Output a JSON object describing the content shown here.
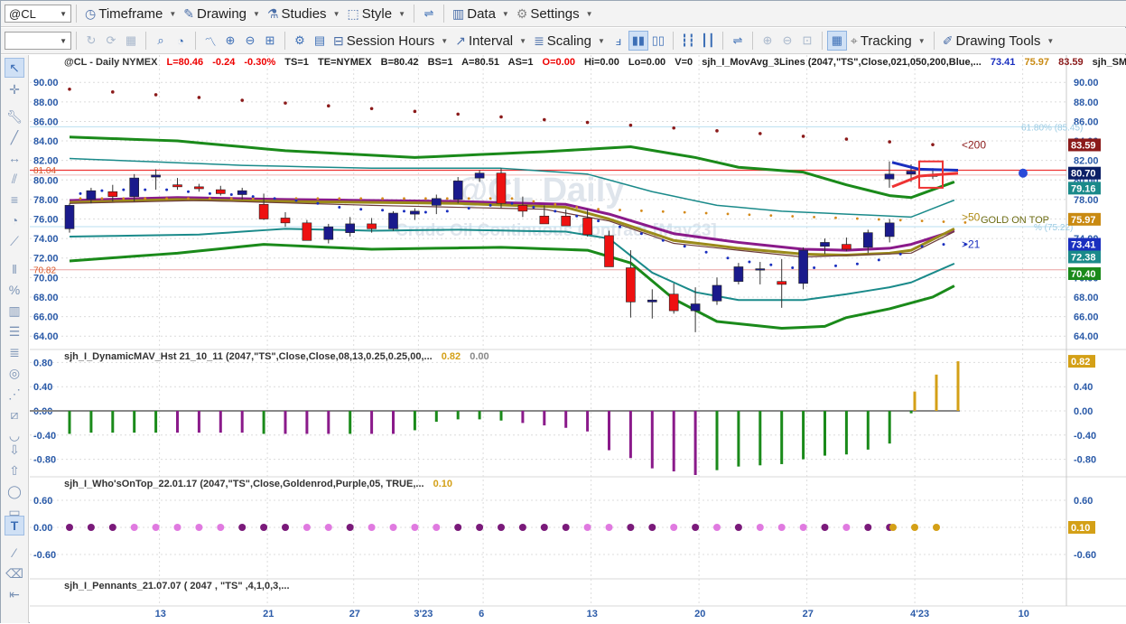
{
  "toolbar1": {
    "symbol": "@CL",
    "timeframe": "Timeframe",
    "drawing": "Drawing",
    "studies": "Studies",
    "style": "Style",
    "data": "Data",
    "settings": "Settings"
  },
  "toolbar2": {
    "session_hours": "Session Hours",
    "interval": "Interval",
    "scaling": "Scaling",
    "tracking": "Tracking",
    "drawing_tools": "Drawing Tools"
  },
  "header": {
    "symbol": "@CL - Daily  NYMEX",
    "last": "L=80.46",
    "change": "-0.24",
    "pct": "-0.30%",
    "ts": "TS=1",
    "te": "TE=NYMEX",
    "bid": "B=80.42",
    "bs": "BS=1",
    "ask": "A=80.51",
    "as": "AS=1",
    "open": "O=0.00",
    "hi": "Hi=0.00",
    "lo": "Lo=0.00",
    "vol": "V=0",
    "study1": "sjh_I_MovAvg_3Lines (2047,\"TS\",Close,021,050,200,Blue,...",
    "study1_v1": "73.41",
    "study1_v2": "75.97",
    "study1_v3": "83.59",
    "study2": "sjh_SM_Curr..."
  },
  "watermark": {
    "title": "@CL Daily",
    "subtitle": "Crude Oil Continuous Contract [May23]"
  },
  "annotations": {
    "ma200": "<200",
    "ma50": ">50",
    "ma21": ">21",
    "gold": "GOLD ON TOP",
    "fib618": "61.80% (85.45)",
    "fib": "% (75.22)",
    "hline_top": "81.04",
    "hline_bot": "70.82"
  },
  "colors": {
    "up": "#1a1a8c",
    "down": "#ee1111",
    "purple": "#8a1a8a",
    "green": "#1a8a1a",
    "gold": "#d4a017",
    "teal": "#1a8a8a"
  },
  "price_pane": {
    "axis_ticks": [
      "90.00",
      "88.00",
      "86.00",
      "84.00",
      "82.00",
      "80.00",
      "78.00",
      "76.00",
      "74.00",
      "72.00",
      "70.00",
      "68.00",
      "66.00",
      "64.00"
    ],
    "tags": [
      {
        "text": "83.59",
        "color": "#8b1a1a"
      },
      {
        "text": "80.70",
        "color": "#0b1f66"
      },
      {
        "text": "79.16",
        "color": "#1a8a8a"
      },
      {
        "text": "75.97",
        "color": "#c98a12"
      },
      {
        "text": "73.41",
        "color": "#1a2fbf"
      },
      {
        "text": "72.38",
        "color": "#1a8a8a"
      },
      {
        "text": "70.40",
        "color": "#1a8a1a"
      }
    ]
  },
  "pane2": {
    "title": "sjh_I_DynamicMAV_Hst 21_10_11 (2047,\"TS\",Close,Close,08,13,0.25,0.25,00,...",
    "v1": "0.82",
    "v2": "0.00",
    "axis_ticks": [
      "0.80",
      "0.40",
      "0.00",
      "-0.40",
      "-0.80"
    ],
    "tags": [
      "0.82",
      "-0.00"
    ]
  },
  "pane3": {
    "title": "sjh_I_Who'sOnTop_22.01.17 (2047,\"TS\",Close,Goldenrod,Purple,05, TRUE,...",
    "v1": "0.10",
    "axis_ticks": [
      "0.60",
      "0.00",
      "-0.60"
    ],
    "tag": "0.10"
  },
  "pane4": {
    "title": "sjh_I_Pennants_21.07.07 ( 2047 , \"TS\" ,4,1,0,3,..."
  },
  "date_axis": [
    "13",
    "21",
    "27",
    "3'23",
    "6",
    "13",
    "20",
    "27",
    "4'23",
    "10"
  ],
  "chart_data": {
    "type": "candlestick",
    "ylim": [
      63,
      91
    ],
    "candles": [
      {
        "o": 75,
        "h": 77.6,
        "l": 74.6,
        "c": 77.4
      },
      {
        "o": 78.0,
        "h": 79.2,
        "l": 77.6,
        "c": 78.9
      },
      {
        "o": 78.8,
        "h": 79.5,
        "l": 77.8,
        "c": 78.3
      },
      {
        "o": 78.3,
        "h": 80.6,
        "l": 77.8,
        "c": 80.2
      },
      {
        "o": 80.3,
        "h": 81.1,
        "l": 79.0,
        "c": 80.5
      },
      {
        "o": 79.5,
        "h": 80.2,
        "l": 79.0,
        "c": 79.3
      },
      {
        "o": 79.3,
        "h": 79.6,
        "l": 78.8,
        "c": 79.1
      },
      {
        "o": 79.0,
        "h": 79.4,
        "l": 78.4,
        "c": 78.6
      },
      {
        "o": 78.5,
        "h": 79.2,
        "l": 78.0,
        "c": 78.9
      },
      {
        "o": 77.5,
        "h": 78.6,
        "l": 75.9,
        "c": 76.0
      },
      {
        "o": 76.1,
        "h": 76.7,
        "l": 75.2,
        "c": 75.6
      },
      {
        "o": 75.6,
        "h": 75.9,
        "l": 73.9,
        "c": 73.8
      },
      {
        "o": 73.9,
        "h": 75.5,
        "l": 73.5,
        "c": 75.2
      },
      {
        "o": 74.6,
        "h": 76.2,
        "l": 74.2,
        "c": 75.5
      },
      {
        "o": 75.5,
        "h": 76.1,
        "l": 74.6,
        "c": 75.0
      },
      {
        "o": 75.0,
        "h": 76.8,
        "l": 74.8,
        "c": 76.6
      },
      {
        "o": 76.5,
        "h": 77.1,
        "l": 75.9,
        "c": 76.8
      },
      {
        "o": 77.4,
        "h": 78.5,
        "l": 76.5,
        "c": 78.1
      },
      {
        "o": 78.0,
        "h": 80.3,
        "l": 77.6,
        "c": 79.9
      },
      {
        "o": 80.2,
        "h": 81.0,
        "l": 79.8,
        "c": 80.7
      },
      {
        "o": 80.7,
        "h": 81.2,
        "l": 77.1,
        "c": 77.6
      },
      {
        "o": 77.4,
        "h": 78.3,
        "l": 76.2,
        "c": 76.8
      },
      {
        "o": 76.3,
        "h": 77.4,
        "l": 75.6,
        "c": 75.5
      },
      {
        "o": 76.3,
        "h": 77.0,
        "l": 75.6,
        "c": 75.3
      },
      {
        "o": 76.1,
        "h": 77.0,
        "l": 74.2,
        "c": 74.4
      },
      {
        "o": 74.3,
        "h": 74.8,
        "l": 71.9,
        "c": 71.1
      },
      {
        "o": 71.0,
        "h": 72.8,
        "l": 65.9,
        "c": 67.5
      },
      {
        "o": 67.5,
        "h": 68.8,
        "l": 65.8,
        "c": 67.7
      },
      {
        "o": 68.3,
        "h": 69.4,
        "l": 66.3,
        "c": 66.6
      },
      {
        "o": 66.6,
        "h": 69.0,
        "l": 64.4,
        "c": 67.3
      },
      {
        "o": 67.6,
        "h": 70.0,
        "l": 67.2,
        "c": 69.2
      },
      {
        "o": 69.6,
        "h": 71.5,
        "l": 69.3,
        "c": 71.1
      },
      {
        "o": 70.8,
        "h": 71.6,
        "l": 69.3,
        "c": 70.9
      },
      {
        "o": 69.6,
        "h": 71.9,
        "l": 66.9,
        "c": 69.3
      },
      {
        "o": 69.4,
        "h": 73.1,
        "l": 68.8,
        "c": 72.8
      },
      {
        "o": 73.2,
        "h": 74.0,
        "l": 72.4,
        "c": 73.6
      },
      {
        "o": 73.4,
        "h": 74.1,
        "l": 72.7,
        "c": 72.9
      },
      {
        "o": 73.1,
        "h": 74.9,
        "l": 72.5,
        "c": 74.6
      },
      {
        "o": 74.2,
        "h": 76.0,
        "l": 73.6,
        "c": 75.6
      },
      {
        "o": 80.1,
        "h": 81.9,
        "l": 79.2,
        "c": 80.6
      },
      {
        "o": 80.6,
        "h": 81.6,
        "l": 79.8,
        "c": 80.9
      },
      {
        "o": 80.5,
        "h": 81.2,
        "l": 80.1,
        "c": 80.4
      }
    ],
    "hist": [
      -0.38,
      -0.36,
      -0.36,
      -0.36,
      -0.36,
      -0.36,
      -0.36,
      -0.36,
      -0.36,
      -0.38,
      -0.38,
      -0.38,
      -0.38,
      -0.38,
      -0.38,
      -0.38,
      -0.32,
      -0.18,
      -0.14,
      -0.14,
      -0.16,
      -0.2,
      -0.24,
      -0.28,
      -0.34,
      -0.65,
      -0.78,
      -0.95,
      -1.0,
      -1.06,
      -0.98,
      -0.92,
      -0.9,
      -0.88,
      -0.8,
      -0.74,
      -0.72,
      -0.64,
      -0.54,
      -0.04,
      0.32,
      0.6,
      0.82
    ],
    "hist_colors": [
      "g",
      "g",
      "g",
      "g",
      "g",
      "p",
      "p",
      "p",
      "p",
      "g",
      "p",
      "p",
      "p",
      "g",
      "p",
      "p",
      "g",
      "g",
      "g",
      "g",
      "g",
      "p",
      "p",
      "p",
      "p",
      "p",
      "p",
      "p",
      "p",
      "p",
      "g",
      "g",
      "g",
      "g",
      "g",
      "g",
      "g",
      "g",
      "g",
      "g",
      "o",
      "o",
      "o"
    ],
    "dots": [
      "p",
      "p",
      "p",
      "m",
      "m",
      "m",
      "m",
      "m",
      "p",
      "p",
      "p",
      "m",
      "m",
      "p",
      "m",
      "m",
      "m",
      "m",
      "p",
      "p",
      "p",
      "p",
      "p",
      "p",
      "m",
      "m",
      "p",
      "p",
      "m",
      "p",
      "m",
      "p",
      "m",
      "m",
      "m",
      "p",
      "m",
      "p",
      "p",
      "o",
      "o",
      "o"
    ]
  }
}
